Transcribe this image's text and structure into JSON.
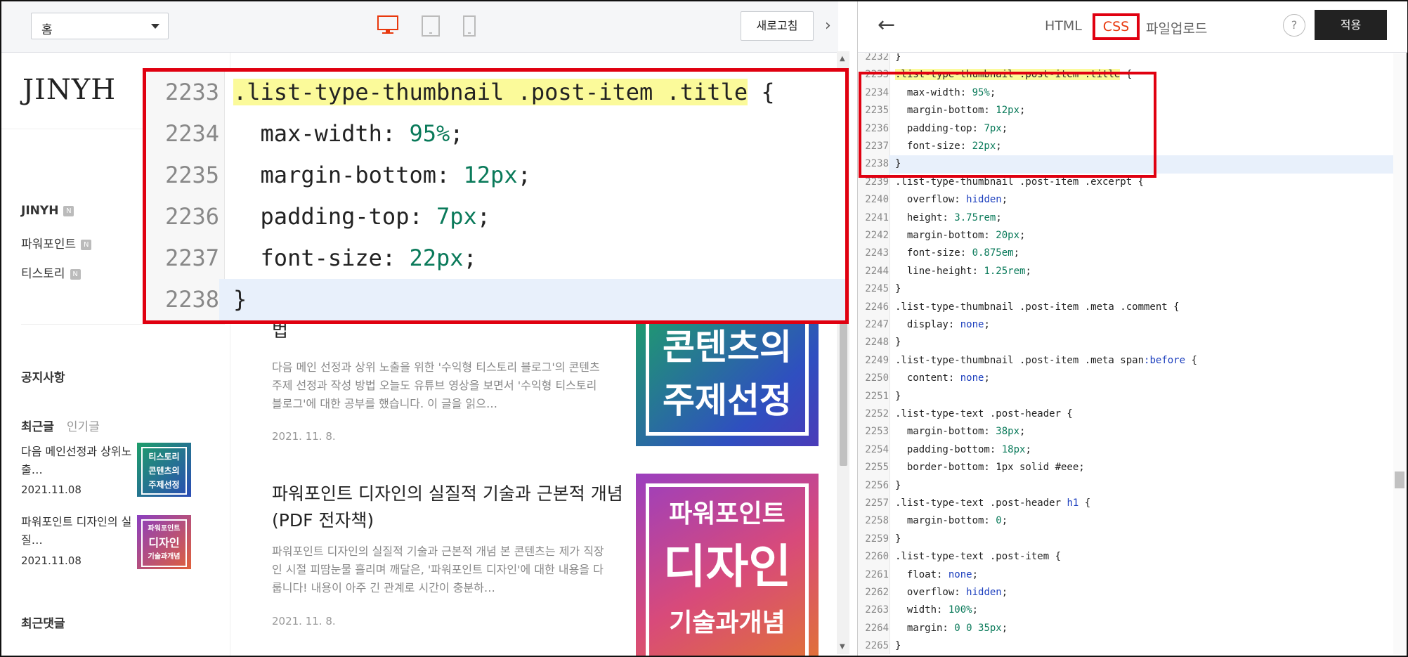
{
  "left_toolbar": {
    "select_value": "홈",
    "refresh_label": "새로고침",
    "collapse_glyph": "›"
  },
  "blog": {
    "logo": "JINYH",
    "categories": [
      {
        "label": "JINYH",
        "badge": "N"
      },
      {
        "label": "파워포인트",
        "badge": "N"
      },
      {
        "label": "티스토리",
        "badge": "N"
      }
    ],
    "notice": "공지사항",
    "tab_recent": "최근글",
    "tab_popular": "인기글",
    "recent": [
      {
        "title": "다음 메인선정과 상위노출…",
        "date": "2021.11.08",
        "thumb": [
          "티스토리",
          "콘텐츠의",
          "주제선정"
        ]
      },
      {
        "title": "파워포인트 디자인의 실질…",
        "date": "2021.11.08",
        "thumb": [
          "파워포인트",
          "디자인",
          "기술과개념"
        ]
      }
    ],
    "comments": "최근댓글"
  },
  "posts": [
    {
      "title": "법",
      "excerpt": "다음 메인 선정과 상위 노출을 위한 '수익형 티스토리 블로그'의 콘텐츠 주제 선정과 작성 방법 오늘도 유튜브 영상을 보면서 '수익형 티스토리 블로그'에 대한 공부를 했습니다. 이 글을 읽으…",
      "date": "2021. 11. 8.",
      "thumb": [
        "콘텐츠의",
        "주제선정"
      ]
    },
    {
      "title": "파워포인트 디자인의 실질적 기술과 근본적 개념 (PDF 전자책)",
      "excerpt": "파워포인트 디자인의 실질적 기술과 근본적 개념 본 콘텐츠는 제가 직장인 시절 피땀눈물 흘리며 깨달은, '파워포인트 디자인'에 대한 내용을 다룹니다! 내용이 아주 긴 관계로 시간이 충분하…",
      "date": "2021. 11. 8.",
      "thumb": [
        "파워포인트",
        "디자인",
        "기술과개념"
      ]
    }
  ],
  "zoom": {
    "lines": [
      {
        "n": "2233",
        "sel": ".list-type-thumbnail .post-item .title",
        "rest": " {"
      },
      {
        "n": "2234",
        "prop": "  max-width: ",
        "val": "95%",
        "end": ";"
      },
      {
        "n": "2235",
        "prop": "  margin-bottom: ",
        "val": "12px",
        "end": ";"
      },
      {
        "n": "2236",
        "prop": "  padding-top: ",
        "val": "7px",
        "end": ";"
      },
      {
        "n": "2237",
        "prop": "  font-size: ",
        "val": "22px",
        "end": ";"
      },
      {
        "n": "2238",
        "prop": "}",
        "val": "",
        "end": ""
      }
    ]
  },
  "right_toolbar": {
    "back_glyph": "←",
    "tab_html": "HTML",
    "tab_css": "CSS",
    "tab_upload": "파일업로드",
    "help": "?",
    "apply": "적용"
  },
  "editor": {
    "lines": [
      [
        "2232",
        "}"
      ],
      [
        "2233",
        ".list-type-thumbnail .post-item .title {"
      ],
      [
        "2234",
        "  max-width: 95%;"
      ],
      [
        "2235",
        "  margin-bottom: 12px;"
      ],
      [
        "2236",
        "  padding-top: 7px;"
      ],
      [
        "2237",
        "  font-size: 22px;"
      ],
      [
        "2238",
        "}"
      ],
      [
        "2239",
        ".list-type-thumbnail .post-item .excerpt {"
      ],
      [
        "2240",
        "  overflow: hidden;"
      ],
      [
        "2241",
        "  height: 3.75rem;"
      ],
      [
        "2242",
        "  margin-bottom: 20px;"
      ],
      [
        "2243",
        "  font-size: 0.875em;"
      ],
      [
        "2244",
        "  line-height: 1.25rem;"
      ],
      [
        "2245",
        "}"
      ],
      [
        "2246",
        ".list-type-thumbnail .post-item .meta .comment {"
      ],
      [
        "2247",
        "  display: none;"
      ],
      [
        "2248",
        "}"
      ],
      [
        "2249",
        ".list-type-thumbnail .post-item .meta span:before {"
      ],
      [
        "2250",
        "  content: none;"
      ],
      [
        "2251",
        "}"
      ],
      [
        "2252",
        ".list-type-text .post-header {"
      ],
      [
        "2253",
        "  margin-bottom: 38px;"
      ],
      [
        "2254",
        "  padding-bottom: 18px;"
      ],
      [
        "2255",
        "  border-bottom: 1px solid #eee;"
      ],
      [
        "2256",
        "}"
      ],
      [
        "2257",
        ".list-type-text .post-header h1 {"
      ],
      [
        "2258",
        "  margin-bottom: 0;"
      ],
      [
        "2259",
        "}"
      ],
      [
        "2260",
        ".list-type-text .post-item {"
      ],
      [
        "2261",
        "  float: none;"
      ],
      [
        "2262",
        "  overflow: hidden;"
      ],
      [
        "2263",
        "  width: 100%;"
      ],
      [
        "2264",
        "  margin: 0 0 35px;"
      ],
      [
        "2265",
        "}"
      ]
    ]
  },
  "colors": {
    "highlight_red": "#e00010",
    "css_tab_text": "#e8380d",
    "selector_highlight": "#fbfa9a",
    "number_green": "#0a7a5a",
    "keyword_blue": "#1a3dbd"
  }
}
